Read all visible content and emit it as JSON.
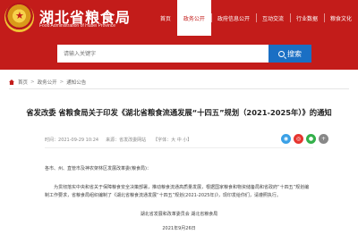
{
  "header": {
    "title": "湖北省粮食局",
    "subtitle": "Food Administration of Hubei Province",
    "nav": [
      "首页",
      "政务公开",
      "政府信息公开",
      "互动交流",
      "行业数据",
      "粮食文化"
    ],
    "active_nav_index": 1,
    "accent_color": "#c31c1a"
  },
  "search": {
    "placeholder": "请输入关键字",
    "button_label": "搜索",
    "button_color": "#1a6fc4"
  },
  "breadcrumb": {
    "items": [
      "首页",
      "政务公开",
      "通知公告"
    ],
    "separator": ">"
  },
  "article": {
    "title": "省发改委 省粮食局关于印发《湖北省粮食流通发展“十四五”规划（2021-2025年）》的通知",
    "date_label": "时间：",
    "date": "2021-09-29 10:24",
    "source_label": "来源：",
    "source": "省发改委网站",
    "font_label": "【字体：大 中 小】",
    "paragraph1": "各市、州、直管市及神农架林区发展改革委(粮食局)：",
    "paragraph2": "为贯彻落实中央和省关于保障粮食安全决策部署，推动粮食流通高质量发展，根据国家粮食和物资储备局和省政府“十四五”规划编制工作要求，省粮食局组织编制了《湖北省粮食流通发展“十四五”规划(2021-2025年)》，现印发给你们，请遵照执行。",
    "signature": "湖北省发展和改革委员会    湖北省粮食局",
    "sign_date": "2021年9月26日"
  }
}
